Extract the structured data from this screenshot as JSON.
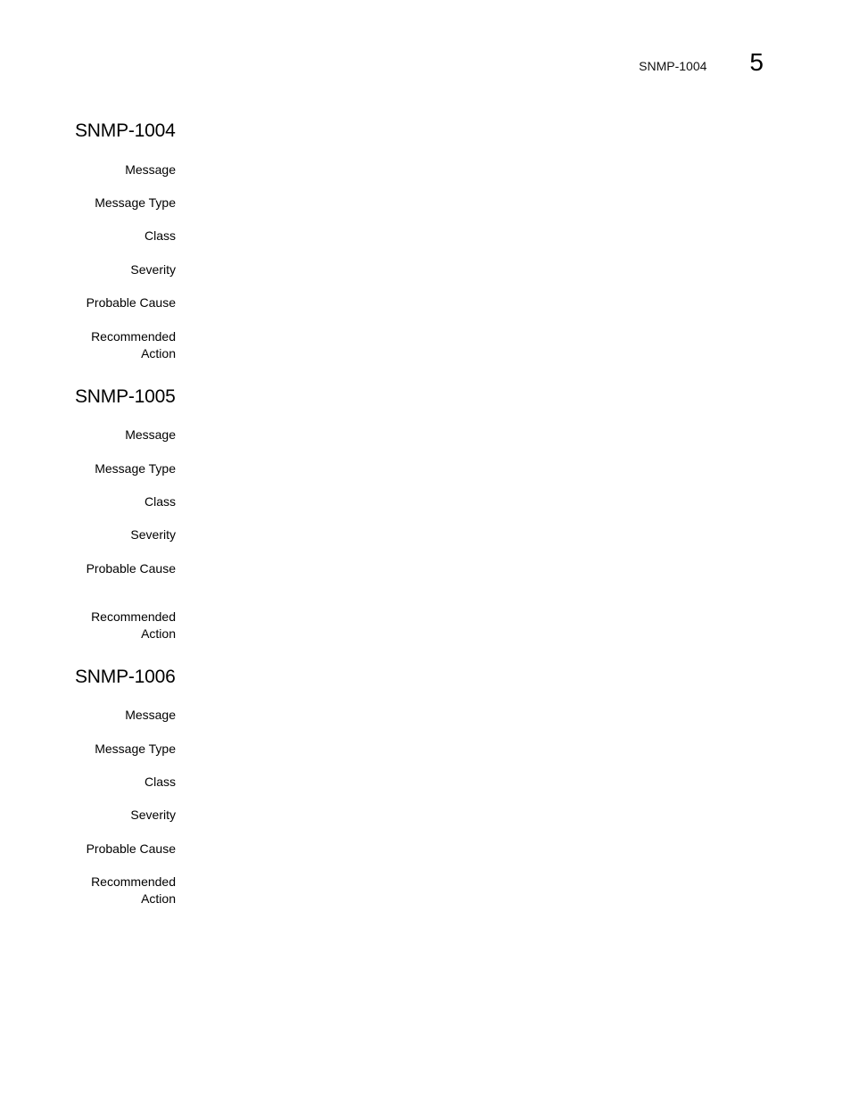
{
  "header": {
    "running_title": "SNMP-1004",
    "chapter_number": "5"
  },
  "entries": [
    {
      "title": "SNMP-1004",
      "fields": [
        {
          "label": "Message",
          "value": ""
        },
        {
          "label": "Message Type",
          "value": ""
        },
        {
          "label": "Class",
          "value": ""
        },
        {
          "label": "Severity",
          "value": ""
        },
        {
          "label": "Probable Cause",
          "value": ""
        },
        {
          "label_line1": "Recommended",
          "label_line2": "Action",
          "value": ""
        }
      ]
    },
    {
      "title": "SNMP-1005",
      "fields": [
        {
          "label": "Message",
          "value": ""
        },
        {
          "label": "Message Type",
          "value": ""
        },
        {
          "label": "Class",
          "value": ""
        },
        {
          "label": "Severity",
          "value": ""
        },
        {
          "label": "Probable Cause",
          "value": ""
        },
        {
          "label_line1": "Recommended",
          "label_line2": "Action",
          "value": ""
        }
      ]
    },
    {
      "title": "SNMP-1006",
      "fields": [
        {
          "label": "Message",
          "value": ""
        },
        {
          "label": "Message Type",
          "value": ""
        },
        {
          "label": "Class",
          "value": ""
        },
        {
          "label": "Severity",
          "value": ""
        },
        {
          "label": "Probable Cause",
          "value": ""
        },
        {
          "label_line1": "Recommended",
          "label_line2": "Action",
          "value": ""
        }
      ]
    }
  ]
}
